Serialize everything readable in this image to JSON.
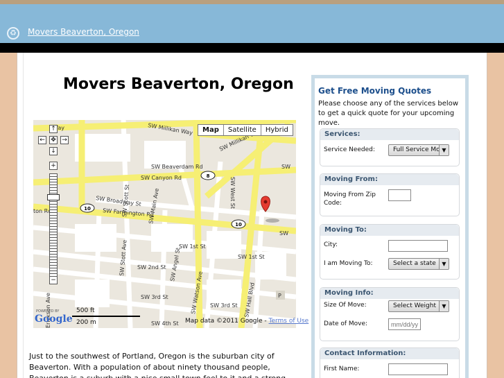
{
  "header": {
    "site_name": "Movers Beaverton, Oregon",
    "logo_icon": "recycle-icon"
  },
  "main": {
    "title": "Movers Beaverton, Oregon",
    "paragraph": "Just to the southwest of Portland, Oregon is the suburban city of Beaverton. With a population of about ninety thousand people, Beaverton is a suburb with a nice small town feel to it and a strong sense of community pride. State"
  },
  "map": {
    "map_types": [
      "Map",
      "Satellite",
      "Hybrid"
    ],
    "scale_imperial": "500 ft",
    "scale_metric": "200 m",
    "logo_small": "POWERED BY",
    "logo": "Google",
    "attribution": "Map data ©2011 Google -",
    "terms_link": "Terms of Use",
    "streets": [
      "SW Millikan Way",
      "SW Millikan Way",
      "SW Beaverdam Rd",
      "SW Canyon Rd",
      "SW Broadway St",
      "SW Farmington Rd",
      "SW 1st St",
      "SW 1st St",
      "SW 2nd St",
      "SW 3rd St",
      "SW 3rd St",
      "SW 4th St",
      "SW West St",
      "SW Main Ave",
      "SW Stott Ave",
      "SW Scott St",
      "SW Angel St",
      "SW Watson Ave",
      "SW Hall Blvd",
      "Erickson Ave",
      "SW",
      "SW",
      "Way",
      "ton Rd",
      "P"
    ],
    "route_shields": [
      "8",
      "10",
      "10"
    ]
  },
  "sidebar": {
    "title": "Get Free Moving Quotes",
    "intro": "Please choose any of the services below to get a quick quote for your upcoming move.",
    "services": {
      "heading": "Services:",
      "label": "Service Needed:",
      "value": "Full Service Moving"
    },
    "moving_from": {
      "heading": "Moving From:",
      "label": "Moving From Zip Code:",
      "value": ""
    },
    "moving_to": {
      "heading": "Moving To:",
      "city_label": "City:",
      "city_value": "",
      "state_label": "I am Moving To:",
      "state_value": "Select a state"
    },
    "moving_info": {
      "heading": "Moving Info:",
      "size_label": "Size Of Move:",
      "size_value": "Select Weight",
      "date_label": "Date of Move:",
      "date_placeholder": "mm/dd/yy"
    },
    "contact": {
      "heading": "Contact Information:",
      "first_name_label": "First Name:",
      "first_name_value": ""
    }
  }
}
